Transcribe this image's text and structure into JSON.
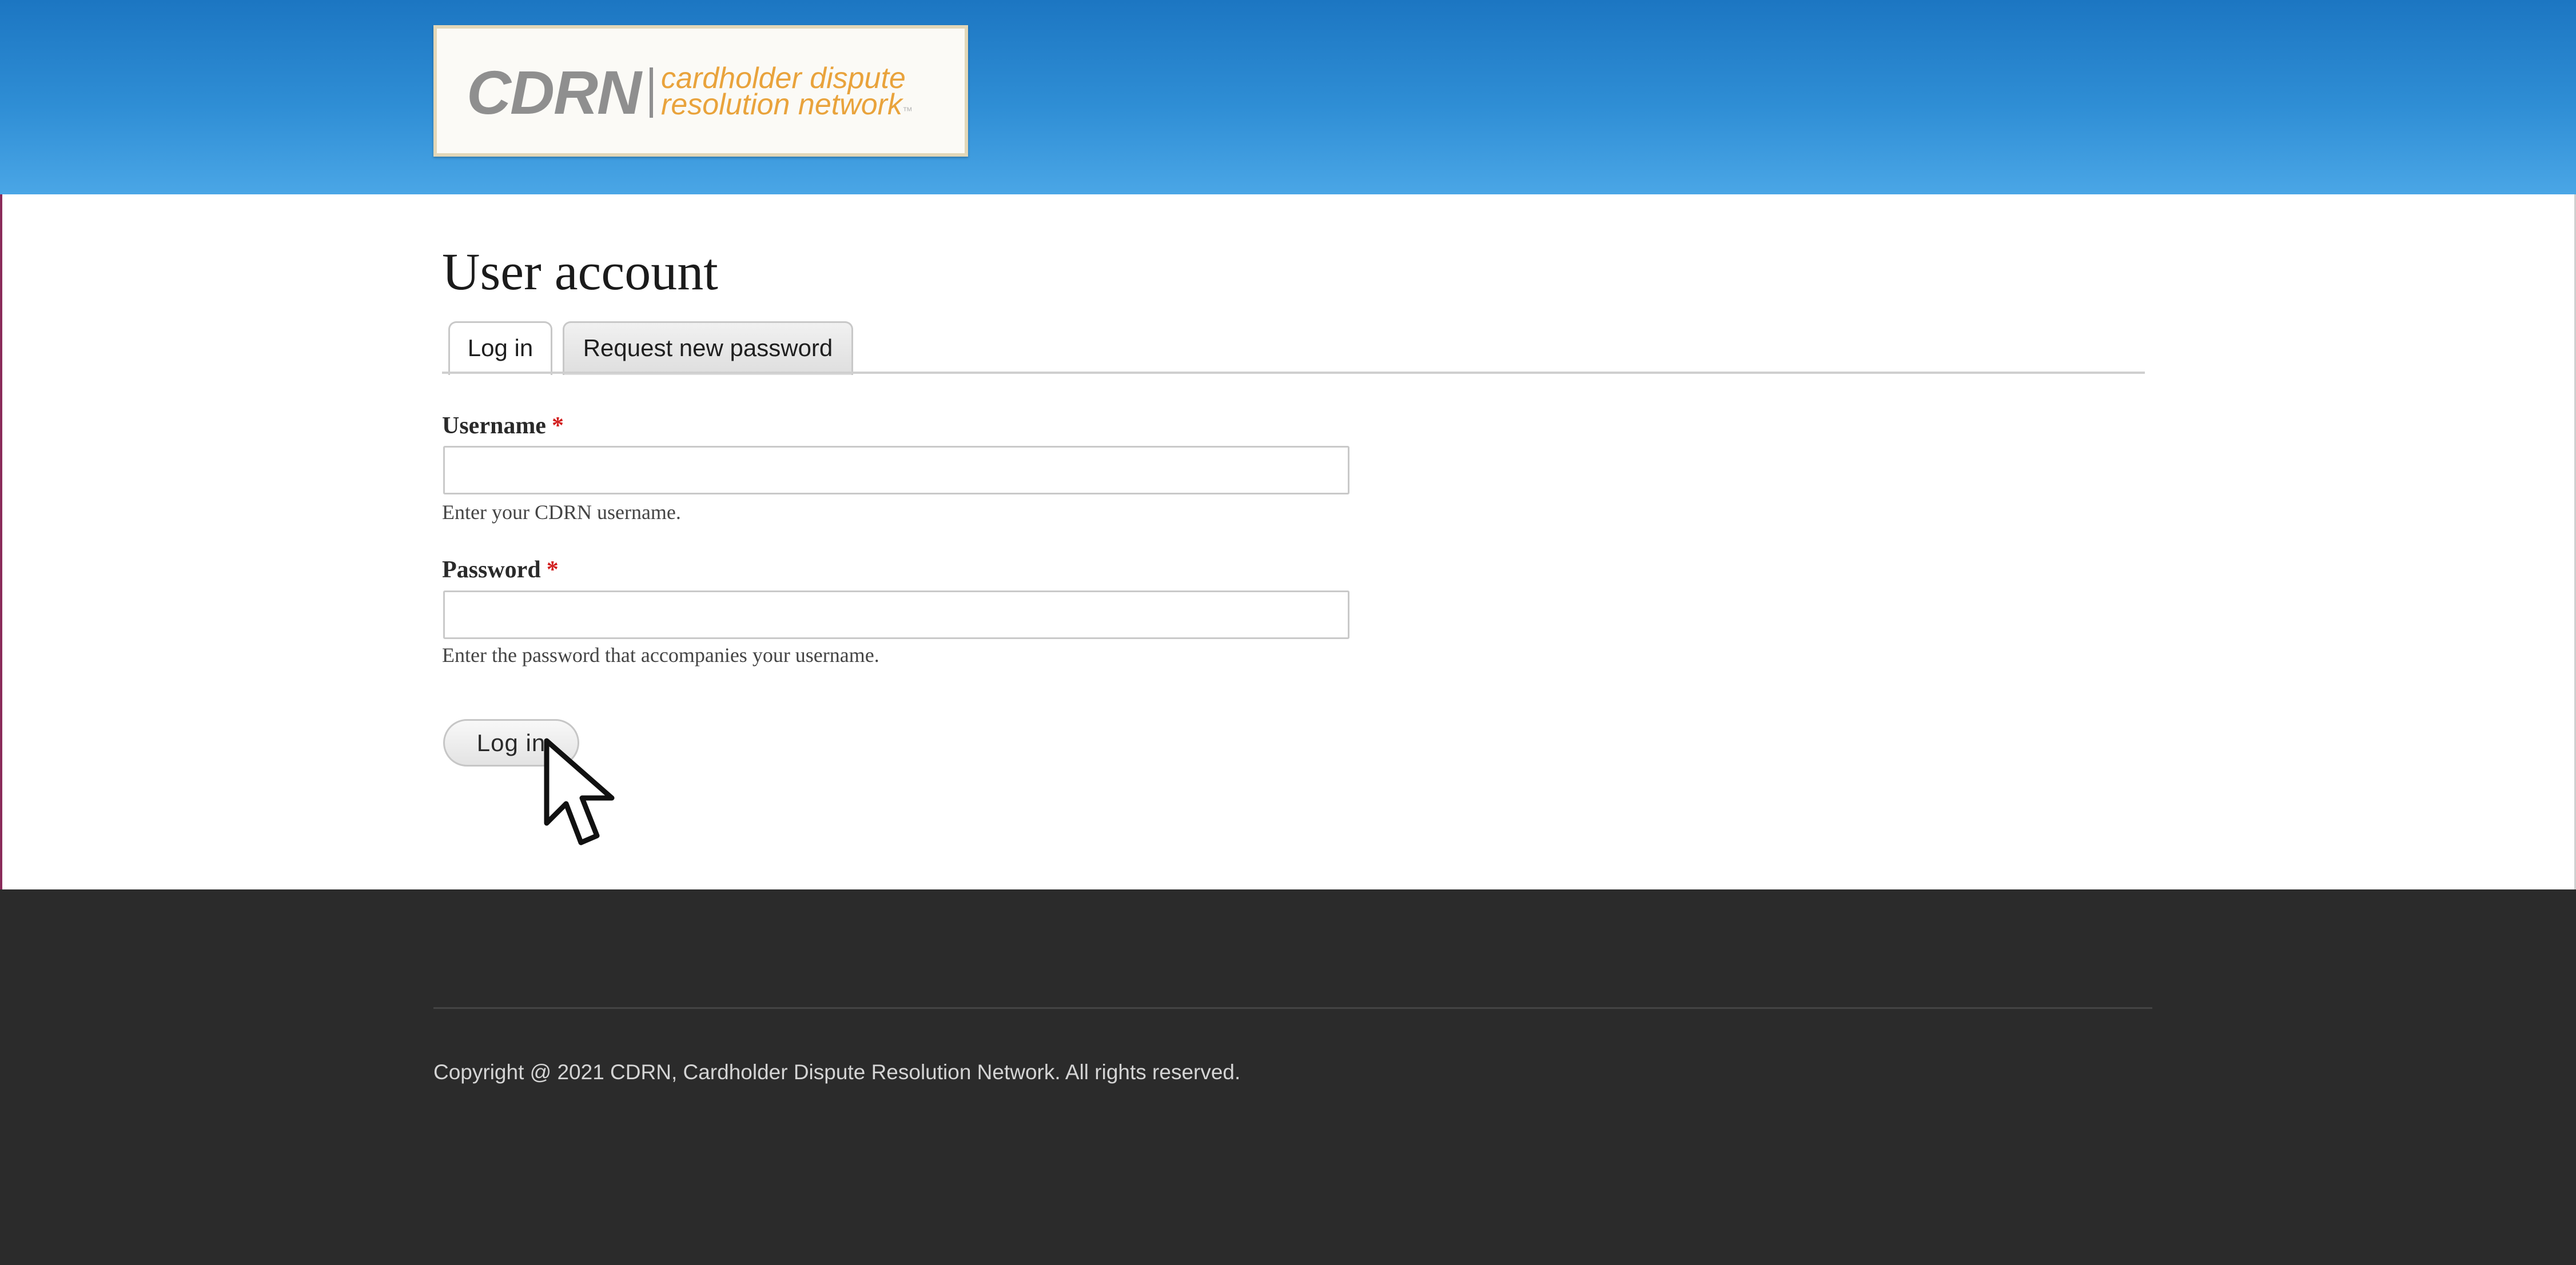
{
  "header": {
    "logo": {
      "mark": "CDRN",
      "line1": "cardholder dispute",
      "line2": "resolution network",
      "tm": "™"
    }
  },
  "main": {
    "title": "User account",
    "tabs": [
      {
        "label": "Log in",
        "active": true
      },
      {
        "label": "Request new password",
        "active": false
      }
    ],
    "form": {
      "username": {
        "label": "Username",
        "required_mark": "*",
        "value": "",
        "help": "Enter your CDRN username."
      },
      "password": {
        "label": "Password",
        "required_mark": "*",
        "value": "",
        "help": "Enter the password that accompanies your username."
      },
      "submit_label": "Log in"
    }
  },
  "footer": {
    "copyright": "Copyright @ 2021 CDRN, Cardholder Dispute Resolution Network. All rights reserved."
  },
  "colors": {
    "header_blue": "#2f8ed5",
    "logo_orange": "#e9a33c",
    "footer_dark": "#2b2b2b",
    "required_red": "#d21f1f"
  },
  "icons": {
    "pointer": "mouse-pointer-icon"
  }
}
